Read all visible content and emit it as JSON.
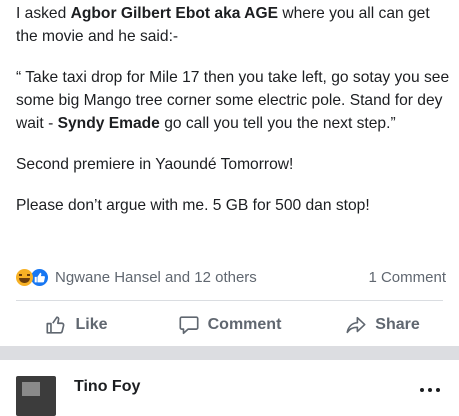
{
  "post": {
    "line1_pre": "I asked ",
    "line1_name": "Agbor Gilbert Ebot aka AGE",
    "line1_post": " where you all can get the movie and he said:-",
    "quote_pre": "“ Take taxi drop for Mile 17 then you take left, go sotay you see some big Mango tree corner some electric pole. Stand for dey wait - ",
    "quote_name": "Syndy Emade",
    "quote_post": " go call you tell you the next step.”",
    "premiere": "Second premiere in Yaoundé Tomorrow!",
    "closing": "Please don’t argue with me. 5 GB for 500 dan stop!"
  },
  "reactions": {
    "icons": [
      "haha-icon",
      "like-icon"
    ],
    "names": "Ngwane Hansel and 12 others",
    "comments": "1 Comment"
  },
  "actions": {
    "like": "Like",
    "comment": "Comment",
    "share": "Share"
  },
  "next_post": {
    "author": "Tino Foy"
  },
  "colors": {
    "text": "#1c1e21",
    "muted": "#606770",
    "like_blue": "#1877f2",
    "haha_yellow": "#f7b125",
    "separator": "#dcdde1"
  }
}
